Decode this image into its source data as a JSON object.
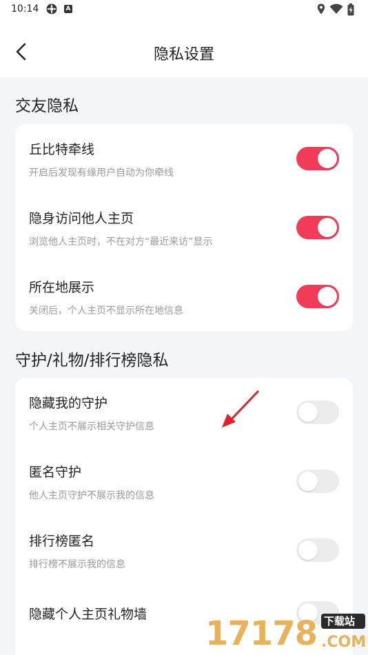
{
  "status_bar": {
    "time": "10:14",
    "a_badge": "A"
  },
  "header": {
    "title": "隐私设置"
  },
  "sections": [
    {
      "title": "交友隐私",
      "items": [
        {
          "label": "丘比特牵线",
          "desc": "开启后发现有缘用户自动为你牵线",
          "enabled": true
        },
        {
          "label": "隐身访问他人主页",
          "desc": "浏览他人主页时，不在对方“最近来访”显示",
          "enabled": true
        },
        {
          "label": "所在地展示",
          "desc": "关闭后，个人主页不显示所在地信息",
          "enabled": true
        }
      ]
    },
    {
      "title": "守护/礼物/排行榜隐私",
      "items": [
        {
          "label": "隐藏我的守护",
          "desc": "个人主页不展示相关守护信息",
          "enabled": false
        },
        {
          "label": "匿名守护",
          "desc": "他人主页守护不展示我的信息",
          "enabled": false
        },
        {
          "label": "排行榜匿名",
          "desc": "排行榜不展示我的信息",
          "enabled": false
        },
        {
          "label": "隐藏个人主页礼物墙",
          "desc": "",
          "enabled": false
        }
      ]
    }
  ],
  "watermark": {
    "digits": "17178",
    "top_label": "下载站",
    "domain": ".COM"
  },
  "colors": {
    "accent": "#f23b59",
    "toggle_off": "#ececec",
    "page_bg": "#f4f5f7",
    "card_bg": "#ffffff",
    "arrow": "#e0202a"
  }
}
